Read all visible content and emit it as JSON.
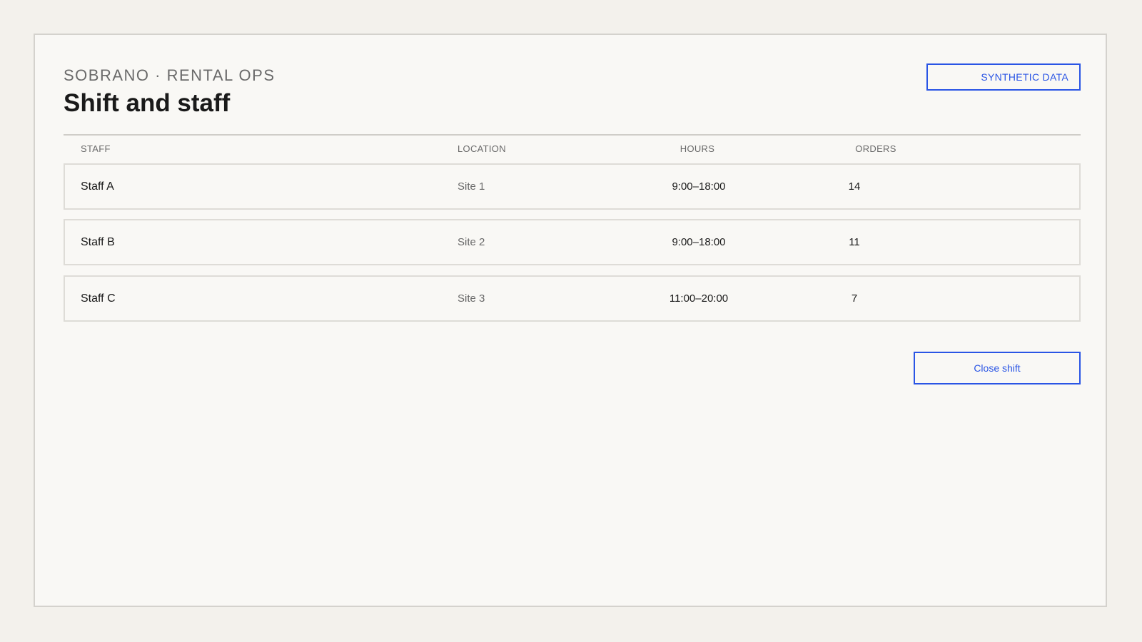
{
  "header": {
    "eyebrow": "SOBRANO · RENTAL OPS",
    "title": "Shift and staff",
    "badge": "SYNTHETIC DATA"
  },
  "table": {
    "columns": {
      "staff": "STAFF",
      "location": "LOCATION",
      "hours": "HOURS",
      "orders": "ORDERS"
    },
    "rows": [
      {
        "staff": "Staff A",
        "location": "Site 1",
        "hours": "9:00–18:00",
        "orders": "14"
      },
      {
        "staff": "Staff B",
        "location": "Site 2",
        "hours": "9:00–18:00",
        "orders": "11"
      },
      {
        "staff": "Staff C",
        "location": "Site 3",
        "hours": "11:00–20:00",
        "orders": "7"
      }
    ]
  },
  "actions": {
    "close_shift": "Close shift"
  },
  "colors": {
    "accent": "#2a55e5",
    "background": "#f3f1ec",
    "panel": "#f9f8f5",
    "text": "#1a1a1a",
    "muted": "#6a6a6a"
  }
}
